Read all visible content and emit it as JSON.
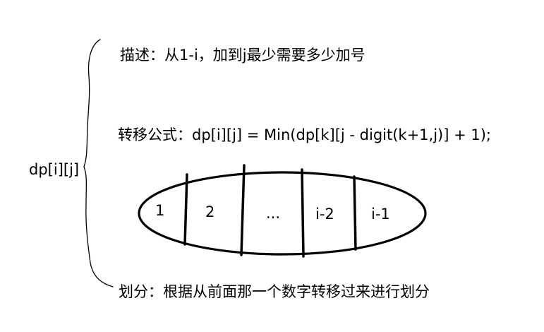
{
  "dp_label": "dp[i][j]",
  "description": "描述：从1-i，加到j最少需要多少加号",
  "transition": "转移公式：dp[i][j] = Min(dp[k][j - digit(k+1,j)] + 1);",
  "partition": "划分：根据从前面那一个数字转移过来进行划分",
  "cells": [
    "1",
    "2",
    "...",
    "i-2",
    "i-1"
  ],
  "colors": {
    "ink": "#000000",
    "background": "#ffffff"
  }
}
